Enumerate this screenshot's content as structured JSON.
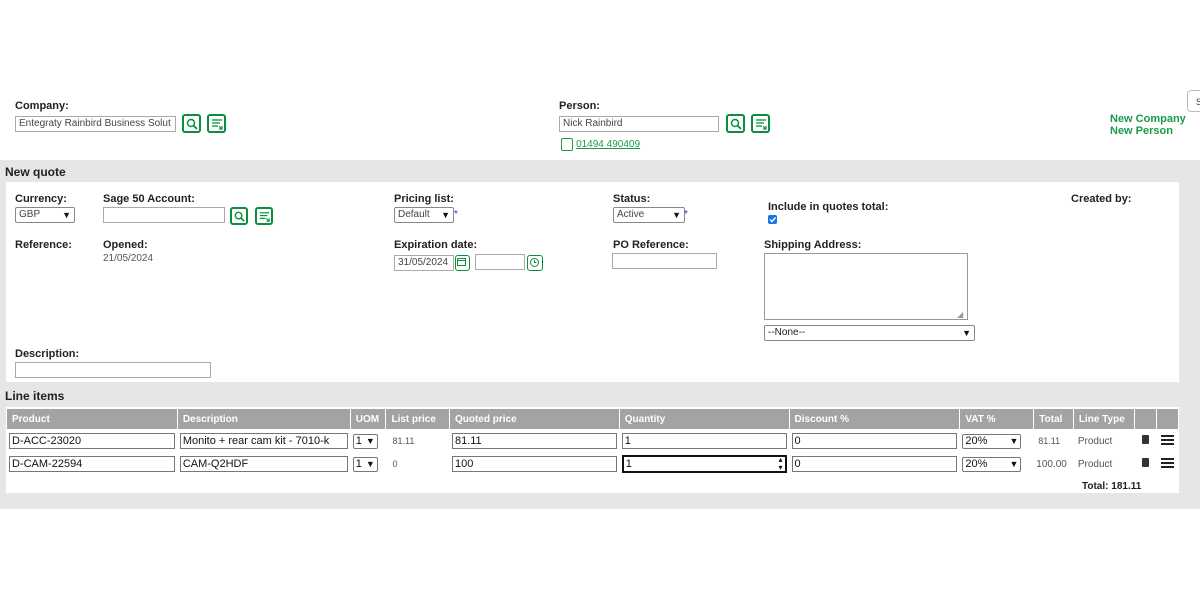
{
  "header": {
    "company_label": "Company:",
    "company_value": "Entegraty Rainbird Business Solut",
    "person_label": "Person:",
    "person_value": "Nick Rainbird",
    "phone": "01494 490409",
    "new_company": "New Company",
    "new_person": "New Person"
  },
  "new_quote": {
    "title": "New quote",
    "currency_label": "Currency:",
    "currency_value": "GBP",
    "sage_label": "Sage 50 Account:",
    "sage_value": "",
    "pricing_label": "Pricing list:",
    "pricing_value": "Default",
    "status_label": "Status:",
    "status_value": "Active",
    "include_label": "Include in quotes total:",
    "include_checked": true,
    "created_label": "Created by:",
    "reference_label": "Reference:",
    "opened_label": "Opened:",
    "opened_value": "21/05/2024",
    "expiration_label": "Expiration date:",
    "expiration_value": "31/05/2024",
    "expiration_time": "",
    "po_label": "PO Reference:",
    "po_value": "",
    "shipping_label": "Shipping Address:",
    "shipping_value": "",
    "shipping_select": "--None--",
    "description_label": "Description:",
    "description_value": "",
    "required_mark": "*"
  },
  "line_items": {
    "title": "Line items",
    "columns": [
      "Product",
      "Description",
      "UOM",
      "List price",
      "Quoted price",
      "Quantity",
      "Discount %",
      "VAT %",
      "Total",
      "Line Type",
      "",
      ""
    ],
    "rows": [
      {
        "product": "D-ACC-23020",
        "description": "Monito + rear cam kit - 7010-k",
        "uom": "1",
        "list_price": "81.11",
        "quoted_price": "81.11",
        "quantity": "1",
        "discount": "0",
        "vat": "20%",
        "total": "81.11",
        "line_type": "Product"
      },
      {
        "product": "D-CAM-22594",
        "description": "CAM-Q2HDF",
        "uom": "1",
        "list_price": "0",
        "quoted_price": "100",
        "quantity": "1",
        "discount": "0",
        "vat": "20%",
        "total": "100.00",
        "line_type": "Product"
      }
    ],
    "grand_total": "Total: 181.11"
  },
  "edge_tab": "S",
  "colors": {
    "accent": "#0a8f3c",
    "header_gray": "#a3a3a3",
    "band": "#e6e6e6",
    "link": "#1a9a4a"
  }
}
